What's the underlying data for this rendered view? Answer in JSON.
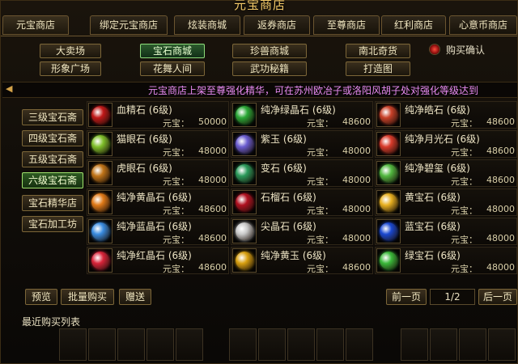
{
  "window": {
    "title": "元宝商店"
  },
  "top_tabs": [
    {
      "label": "元宝商店",
      "active": true
    },
    {
      "label": "绑定元宝商店",
      "active": false
    },
    {
      "label": "炫装商城",
      "active": false
    },
    {
      "label": "返券商店",
      "active": false
    },
    {
      "label": "至尊商店",
      "active": false
    },
    {
      "label": "红利商店",
      "active": false
    },
    {
      "label": "心意币商店",
      "active": false
    }
  ],
  "categories": [
    {
      "label": "大卖场",
      "selected": false
    },
    {
      "label": "宝石商城",
      "selected": true
    },
    {
      "label": "珍兽商城",
      "selected": false
    },
    {
      "label": "南北奇货",
      "selected": false
    },
    {
      "label": "形象广场",
      "selected": false
    },
    {
      "label": "花舞人间",
      "selected": false
    },
    {
      "label": "武功秘籍",
      "selected": false
    },
    {
      "label": "打造图",
      "selected": false
    }
  ],
  "confirm": {
    "label": "购买确认",
    "checked": true
  },
  "marquee": {
    "arrow": "◀",
    "text": "元宝商店上架至尊强化精华，可在苏州欧冶子或洛阳风胡子处对强化等级达到"
  },
  "side_menu": [
    {
      "label": "三级宝石斋",
      "selected": false
    },
    {
      "label": "四级宝石斋",
      "selected": false
    },
    {
      "label": "五级宝石斋",
      "selected": false
    },
    {
      "label": "六级宝石斋",
      "selected": true
    },
    {
      "label": "宝石精华店",
      "selected": false
    },
    {
      "label": "宝石加工坊",
      "selected": false
    }
  ],
  "price_label": "元宝：",
  "items": [
    {
      "name": "血精石 (6级)",
      "price": "50000",
      "color": "#c01818"
    },
    {
      "name": "纯净绿晶石 (6级)",
      "price": "48600",
      "color": "#2aa836"
    },
    {
      "name": "纯净皓石 (6级)",
      "price": "48600",
      "color": "#c84028"
    },
    {
      "name": "猫眼石 (6级)",
      "price": "48000",
      "color": "#7fbf2a"
    },
    {
      "name": "紫玉 (6级)",
      "price": "48000",
      "color": "#6a5cd0"
    },
    {
      "name": "纯净月光石 (6级)",
      "price": "48600",
      "color": "#d83a2a"
    },
    {
      "name": "虎眼石 (6级)",
      "price": "48000",
      "color": "#c07418"
    },
    {
      "name": "变石 (6级)",
      "price": "48000",
      "color": "#2a9a5a"
    },
    {
      "name": "纯净碧玺 (6级)",
      "price": "48600",
      "color": "#52b840"
    },
    {
      "name": "纯净黄晶石 (6级)",
      "price": "48600",
      "color": "#e07a18"
    },
    {
      "name": "石榴石 (6级)",
      "price": "48000",
      "color": "#b01020"
    },
    {
      "name": "黄宝石 (6级)",
      "price": "48000",
      "color": "#e8b020"
    },
    {
      "name": "纯净蓝晶石 (6级)",
      "price": "48600",
      "color": "#3a8ce0"
    },
    {
      "name": "尖晶石 (6级)",
      "price": "48000",
      "color": "#c8c8c8"
    },
    {
      "name": "蓝宝石 (6级)",
      "price": "48000",
      "color": "#1a48d0"
    },
    {
      "name": "纯净红晶石 (6级)",
      "price": "48600",
      "color": "#d8243a"
    },
    {
      "name": "纯净黄玉 (6级)",
      "price": "48600",
      "color": "#d8a010"
    },
    {
      "name": "绿宝石 (6级)",
      "price": "48000",
      "color": "#3ab83a"
    }
  ],
  "bottom": {
    "preview": "预览",
    "bulk_buy": "批量购买",
    "gift": "赠送",
    "prev_page": "前一页",
    "page": "1/2",
    "next_page": "后一页"
  },
  "recent": {
    "label": "最近购买列表"
  }
}
